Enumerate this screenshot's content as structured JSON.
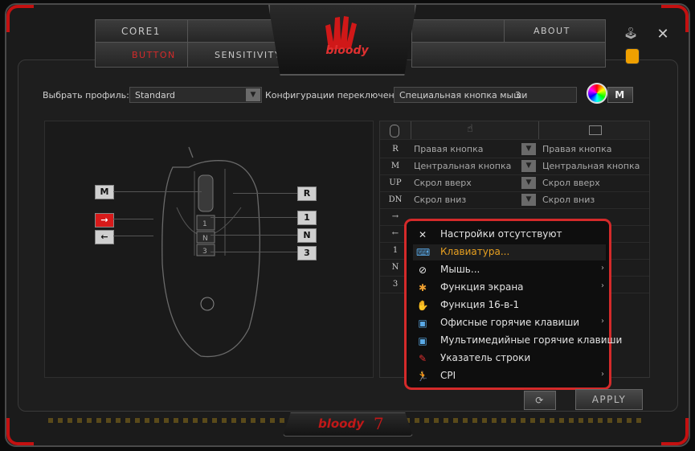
{
  "tabs": {
    "core": "Core1",
    "button": "Button",
    "sensitivity": "Sensitivity",
    "about": "About"
  },
  "brand": {
    "logo_text": "bloody",
    "footer_brand": "bloody",
    "footer_version": "7"
  },
  "profile": {
    "label": "Выбрать профиль:",
    "value": "Standard",
    "switch_label": "Конфигурации переключения :",
    "switch_value": "Специальная кнопка мыши",
    "switch_number": "3",
    "mode_button": "M"
  },
  "mouse_buttons": {
    "left": [
      "M",
      "→",
      "←"
    ],
    "right": [
      "R",
      "1",
      "N",
      "3"
    ]
  },
  "table": {
    "rows": [
      {
        "code": "R",
        "original": "Правая кнопка",
        "assigned": "Правая кнопка"
      },
      {
        "code": "M",
        "original": "Центральная кнопка",
        "assigned": "Центральная кнопка"
      },
      {
        "code": "UP",
        "original": "Скрол вверх",
        "assigned": "Скрол вверх"
      },
      {
        "code": "DN",
        "original": "Скрол вниз",
        "assigned": "Скрол вниз"
      },
      {
        "code": "→",
        "original": "",
        "assigned": ""
      },
      {
        "code": "←",
        "original": "",
        "assigned": ""
      },
      {
        "code": "1",
        "original": "",
        "assigned": ""
      },
      {
        "code": "N",
        "original": "",
        "assigned": ""
      },
      {
        "code": "3",
        "original": "",
        "assigned": ""
      }
    ]
  },
  "menu": {
    "items": [
      {
        "label": "Настройки отсутствуют",
        "icon": "no-settings-icon",
        "submenu": false
      },
      {
        "label": "Клавиатура...",
        "icon": "keyboard-icon",
        "submenu": false,
        "selected": true
      },
      {
        "label": "Мышь...",
        "icon": "mouse-icon",
        "submenu": true
      },
      {
        "label": "Функция экрана",
        "icon": "screen-function-icon",
        "submenu": true
      },
      {
        "label": "Функция 16-в-1",
        "icon": "hand-icon",
        "submenu": false
      },
      {
        "label": "Офисные горячие клавиши",
        "icon": "office-hotkeys-icon",
        "submenu": true
      },
      {
        "label": "Мультимедийные горячие клавиши",
        "icon": "multimedia-hotkeys-icon",
        "submenu": true
      },
      {
        "label": "Указатель строки",
        "icon": "pointer-icon",
        "submenu": false
      },
      {
        "label": "CPI",
        "icon": "runner-icon",
        "submenu": true
      }
    ]
  },
  "actions": {
    "apply": "APPLY"
  },
  "colors": {
    "accent": "#d42a2a",
    "selected_text": "#e8a020",
    "frame": "#c41010"
  }
}
